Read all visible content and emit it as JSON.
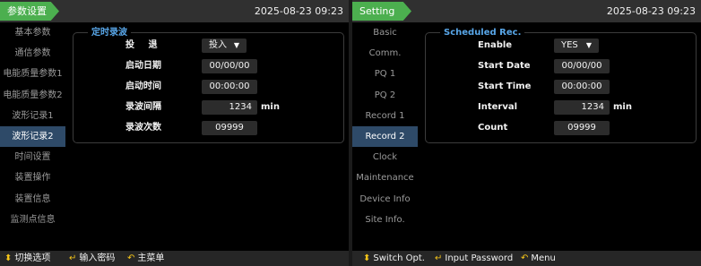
{
  "colors": {
    "accent_green": "#4caf4f",
    "active_item": "#2e4a68",
    "group_title": "#58a6e8",
    "hint_icon": "#f5c518"
  },
  "panels": [
    {
      "title": "参数设置",
      "clock": "2025-08-23 09:23",
      "sidebar": [
        {
          "label": "基本参数"
        },
        {
          "label": "通信参数"
        },
        {
          "label": "电能质量参数1"
        },
        {
          "label": "电能质量参数2"
        },
        {
          "label": "波形记录1"
        },
        {
          "label": "波形记录2",
          "active": true
        },
        {
          "label": "时间设置"
        },
        {
          "label": "装置操作"
        },
        {
          "label": "装置信息"
        },
        {
          "label": "监测点信息"
        }
      ],
      "group_title": "定时录波",
      "fields": {
        "enable": {
          "label": "投  退",
          "value": "投入"
        },
        "start_date": {
          "label": "启动日期",
          "value": "00/00/00"
        },
        "start_time": {
          "label": "启动时间",
          "value": "00:00:00"
        },
        "interval": {
          "label": "录波间隔",
          "value": "1234",
          "unit": "min"
        },
        "count": {
          "label": "录波次数",
          "value": "09999"
        }
      },
      "footer": {
        "switch": "切换选项",
        "password": "输入密码",
        "menu": "主菜单"
      }
    },
    {
      "title": "Setting",
      "clock": "2025-08-23 09:23",
      "sidebar": [
        {
          "label": "Basic"
        },
        {
          "label": "Comm."
        },
        {
          "label": "PQ 1"
        },
        {
          "label": "PQ 2"
        },
        {
          "label": "Record 1"
        },
        {
          "label": "Record 2",
          "active": true
        },
        {
          "label": "Clock"
        },
        {
          "label": "Maintenance"
        },
        {
          "label": "Device Info"
        },
        {
          "label": "Site Info."
        }
      ],
      "group_title": "Scheduled Rec.",
      "fields": {
        "enable": {
          "label": "Enable",
          "value": "YES"
        },
        "start_date": {
          "label": "Start Date",
          "value": "00/00/00"
        },
        "start_time": {
          "label": "Start Time",
          "value": "00:00:00"
        },
        "interval": {
          "label": "Interval",
          "value": "1234",
          "unit": "min"
        },
        "count": {
          "label": "Count",
          "value": "09999"
        }
      },
      "footer": {
        "switch": "Switch Opt.",
        "password": "Input Password",
        "menu": "Menu"
      }
    }
  ]
}
